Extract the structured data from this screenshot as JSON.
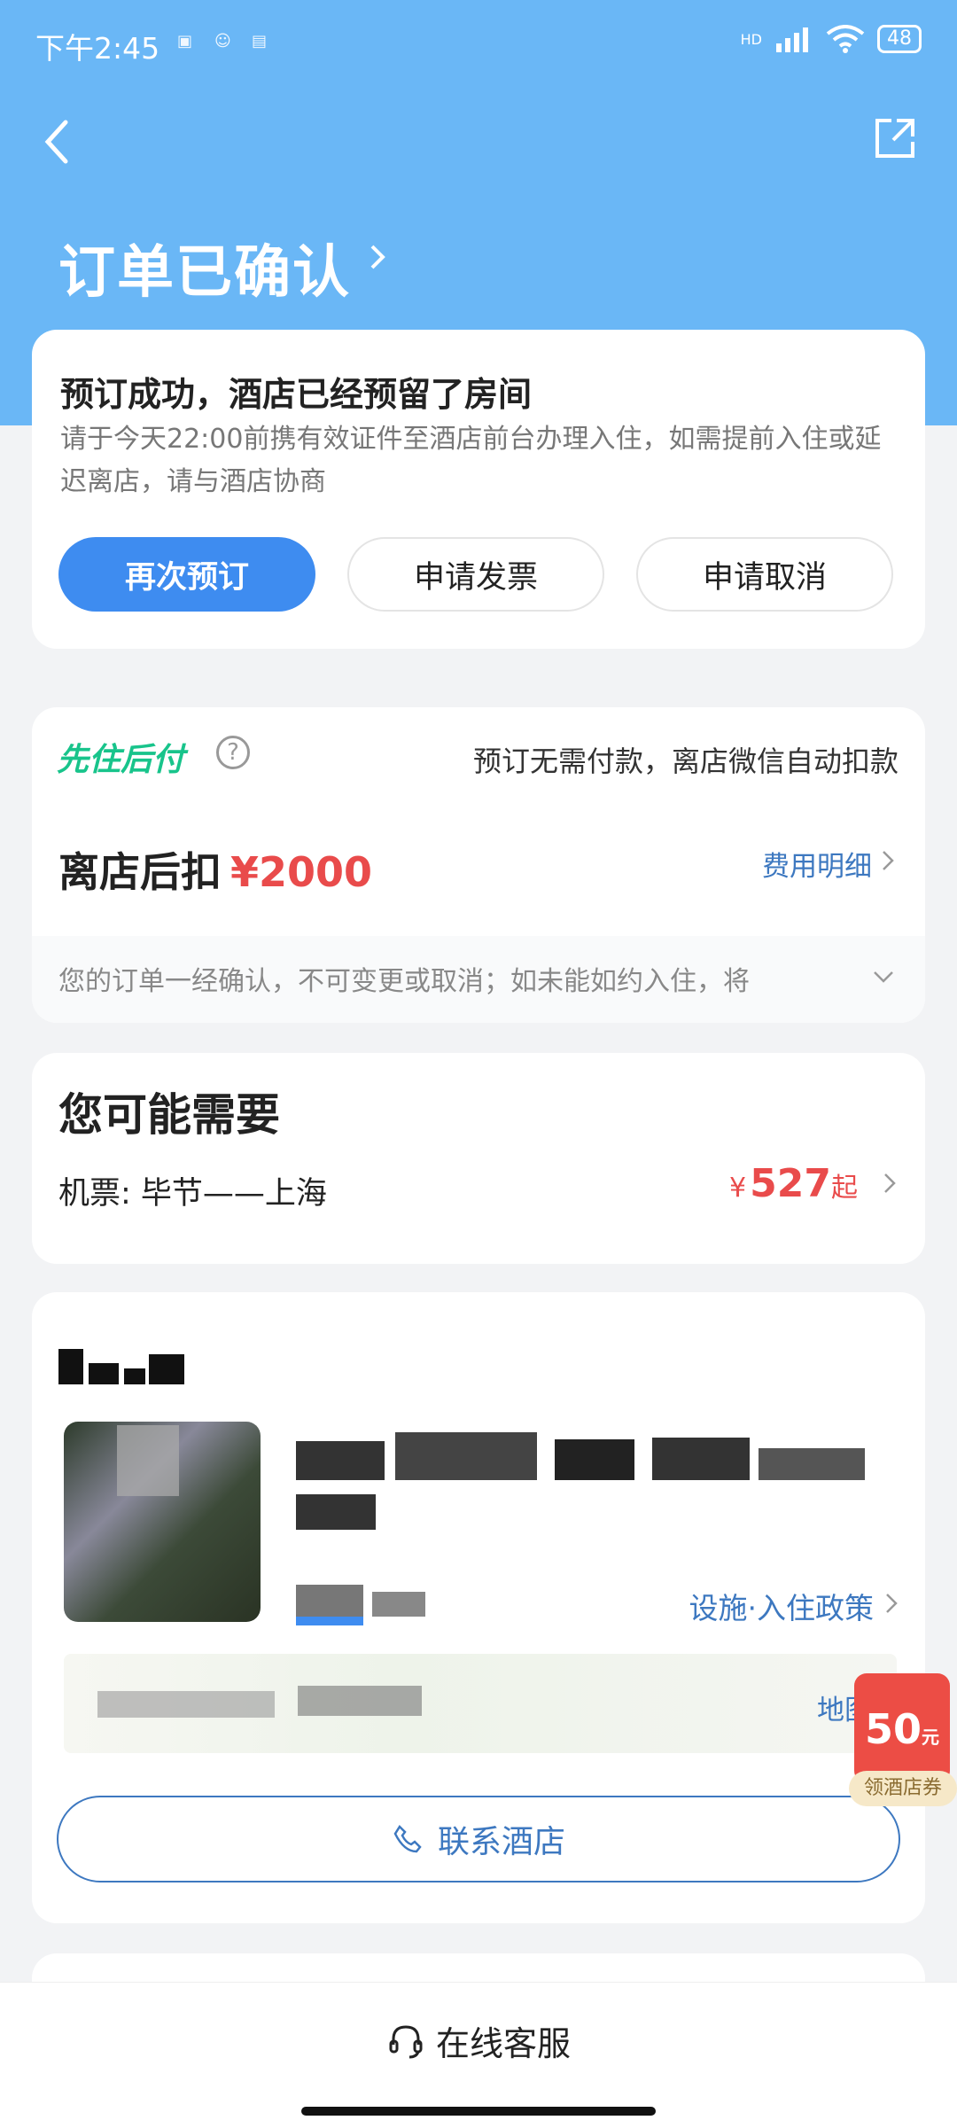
{
  "status_bar": {
    "time": "下午2:45",
    "network": "HD",
    "battery": "48"
  },
  "header": {
    "title": "订单已确认"
  },
  "confirm_card": {
    "heading": "预订成功，酒店已经预留了房间",
    "description": "请于今天22:00前携有效证件至酒店前台办理入住，如需提前入住或延迟离店，请与酒店协商",
    "buttons": [
      "再次预订",
      "申请发票",
      "申请取消"
    ]
  },
  "payment_card": {
    "tag": "先住后付",
    "help_icon": "?",
    "note": "预订无需付款，离店微信自动扣款",
    "pay_label": "离店后扣",
    "amount": "¥2000",
    "detail_link": "费用明细",
    "policy": "您的订单一经确认，不可变更或取消；如未能如约入住，将"
  },
  "recommend_card": {
    "heading": "您可能需要",
    "item_label": "机票: 毕节——上海",
    "currency": "¥",
    "price": "527",
    "price_suffix": "起"
  },
  "hotel_card": {
    "facilities_link": "设施·入住政策",
    "map_link": "地图",
    "contact_button": "联系酒店"
  },
  "coupon": {
    "amount": "50",
    "unit": "元",
    "label": "领酒店券"
  },
  "bottom_bar": {
    "service": "在线客服"
  }
}
